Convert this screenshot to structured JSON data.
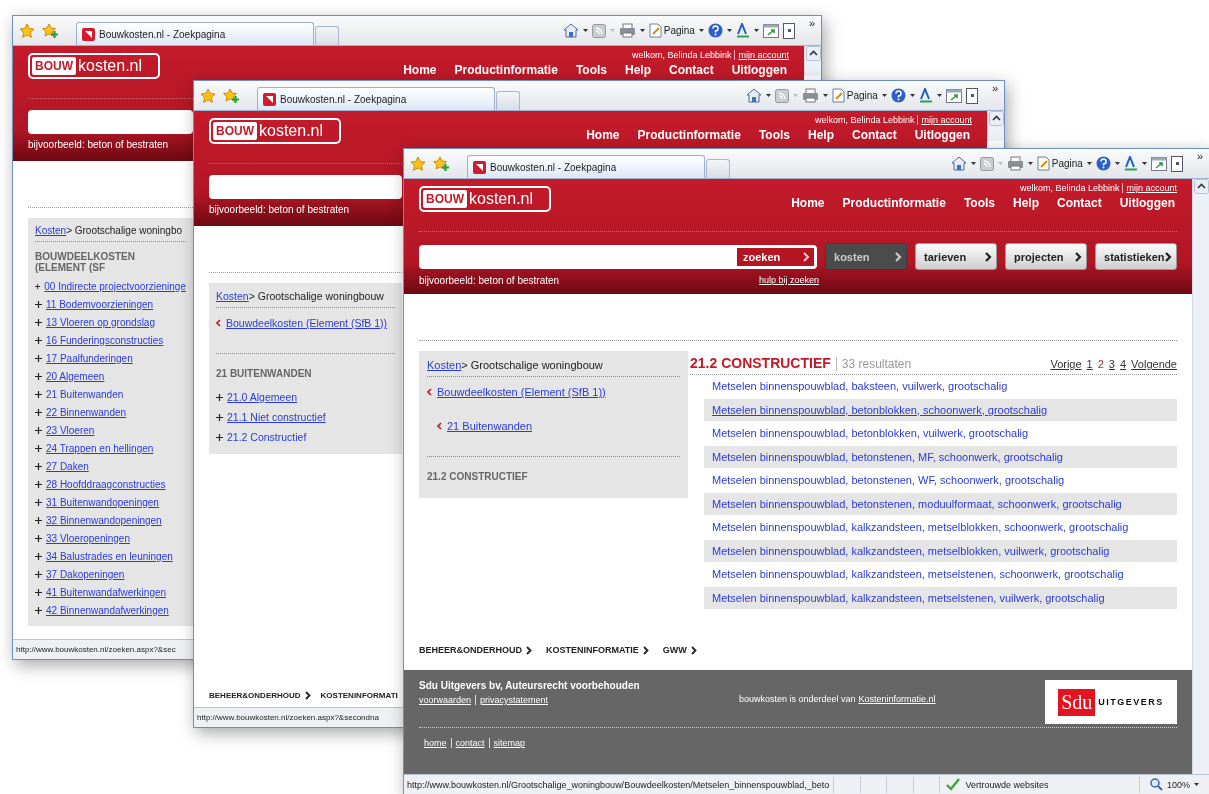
{
  "windows": [
    {
      "tab": "Bouwkosten.nl - Zoekpagina",
      "page_menu": "Pagina",
      "more": "»",
      "header": {
        "logo": [
          "BOUW",
          "kosten.nl"
        ],
        "welcome": "welkom, Belinda Lebbink",
        "account": "mijn account",
        "nav": [
          "Home",
          "Productinformatie",
          "Tools",
          "Help",
          "Contact",
          "Uitloggen"
        ],
        "hint": "bijvoorbeeld: beton of bestraten"
      },
      "sidebar": {
        "breadcrumb": {
          "link": "Kosten",
          "current": "> Grootschalige woningbo"
        },
        "heading": "BOUWDEELKOSTEN (ELEMENT (SF",
        "items": [
          {
            "label": "00 Indirecte projectvoorzieninge",
            "selected": false
          },
          {
            "label": "11 Bodemvoorzieningen",
            "selected": false
          },
          {
            "label": "13 Vloeren op grondslag",
            "selected": false
          },
          {
            "label": "16 Funderingsconstructies",
            "selected": false
          },
          {
            "label": "17 Paalfunderingen",
            "selected": false
          },
          {
            "label": "20 Algemeen",
            "selected": false
          },
          {
            "label": "21 Buitenwanden",
            "selected": true
          },
          {
            "label": "22 Binnenwanden",
            "selected": false
          },
          {
            "label": "23 Vloeren",
            "selected": false
          },
          {
            "label": "24 Trappen en hellingen",
            "selected": false
          },
          {
            "label": "27 Daken",
            "selected": false
          },
          {
            "label": "28 Hoofddraagconstructies",
            "selected": false
          },
          {
            "label": "31 Buitenwandopeningen",
            "selected": false
          },
          {
            "label": "32 Binnenwandopeningen",
            "selected": false
          },
          {
            "label": "33 Vloeropeningen",
            "selected": false
          },
          {
            "label": "34 Balustrades en leuningen",
            "selected": false
          },
          {
            "label": "37 Dakopeningen",
            "selected": false
          },
          {
            "label": "41 Buitenwandafwerkingen",
            "selected": false
          },
          {
            "label": "42 Binnenwandafwerkingen",
            "selected": false
          }
        ]
      },
      "status": {
        "url": "http://www.bouwkosten.nl/zoeken.aspx?&sec"
      }
    },
    {
      "tab": "Bouwkosten.nl - Zoekpagina",
      "page_menu": "Pagina",
      "more": "»",
      "header": {
        "logo": [
          "BOUW",
          "kosten.nl"
        ],
        "welcome": "welkom, Belinda Lebbink",
        "account": "mijn account",
        "nav": [
          "Home",
          "Productinformatie",
          "Tools",
          "Help",
          "Contact",
          "Uitloggen"
        ],
        "hint": "bijvoorbeeld: beton of bestraten"
      },
      "sidebar": {
        "breadcrumb": {
          "link": "Kosten",
          "current": "> Grootschalige woningbouw"
        },
        "back_links": [
          {
            "label": "Bouwdeelkosten (Element (SfB 1))"
          }
        ],
        "heading": "21 BUITENWANDEN",
        "items": [
          {
            "label": "21.0 Algemeen",
            "selected": false
          },
          {
            "label": "21.1 Niet constructief",
            "selected": false
          },
          {
            "label": "21.2 Constructief",
            "selected": true
          }
        ]
      },
      "footer_links": [
        {
          "label": "BEHEER&ONDERHOUD",
          "arrow": true
        },
        {
          "label": "KOSTENINFORMATI",
          "arrow": false
        }
      ],
      "status": {
        "url": "http://www.bouwkosten.nl/zoeken.aspx?&secondna"
      }
    },
    {
      "tab": "Bouwkosten.nl - Zoekpagina",
      "page_menu": "Pagina",
      "more": "»",
      "header": {
        "logo": [
          "BOUW",
          "kosten.nl"
        ],
        "welcome": "welkom, Belinda Lebbink",
        "account": "mijn account",
        "nav": [
          "Home",
          "Productinformatie",
          "Tools",
          "Help",
          "Contact",
          "Uitloggen"
        ],
        "hint": "bijvoorbeeld: beton of bestraten",
        "search_button": "zoeken",
        "help_link": "hulp bij zoeken",
        "categories": [
          {
            "label": "kosten",
            "selected": true
          },
          {
            "label": "tarieven",
            "selected": false
          },
          {
            "label": "projecten",
            "selected": false
          },
          {
            "label": "statistieken",
            "selected": false
          }
        ]
      },
      "sidebar": {
        "breadcrumb": {
          "link": "Kosten",
          "current": "> Grootschalige woningbouw"
        },
        "back_links": [
          {
            "label": "Bouwdeelkosten (Element (SfB 1))",
            "children": [
              {
                "label": "21 Buitenwanden"
              }
            ]
          }
        ],
        "heading": "21.2 CONSTRUCTIEF"
      },
      "results": {
        "title": "21.2 CONSTRUCTIEF",
        "count": "33 resultaten",
        "prev": "Vorige",
        "next": "Volgende",
        "pages": [
          {
            "label": "1",
            "selected": false
          },
          {
            "label": "2",
            "selected": true
          },
          {
            "label": "3",
            "selected": false
          },
          {
            "label": "4",
            "selected": false
          }
        ],
        "rows": [
          {
            "label": "Metselen binnenspouwblad, baksteen, vuilwerk, grootschalig",
            "hovered": false
          },
          {
            "label": "Metselen binnenspouwblad, betonblokken, schoonwerk, grootschalig",
            "hovered": true
          },
          {
            "label": "Metselen binnenspouwblad, betonblokken, vuilwerk, grootschalig",
            "hovered": false
          },
          {
            "label": "Metselen binnenspouwblad, betonstenen, MF, schoonwerk, grootschalig",
            "hovered": false
          },
          {
            "label": "Metselen binnenspouwblad, betonstenen, WF, schoonwerk, grootschalig",
            "hovered": false
          },
          {
            "label": "Metselen binnenspouwblad, betonstenen, moduulformaat, schoonwerk, grootschalig",
            "hovered": false
          },
          {
            "label": "Metselen binnenspouwblad, kalkzandsteen, metselblokken, schoonwerk, grootschalig",
            "hovered": false
          },
          {
            "label": "Metselen binnenspouwblad, kalkzandsteen, metselblokken, vuilwerk, grootschalig",
            "hovered": false
          },
          {
            "label": "Metselen binnenspouwblad, kalkzandsteen, metselstenen, schoonwerk, grootschalig",
            "hovered": false
          },
          {
            "label": "Metselen binnenspouwblad, kalkzandsteen, metselstenen, vuilwerk, grootschalig",
            "hovered": false
          }
        ]
      },
      "footer_links": [
        {
          "label": "BEHEER&ONDERHOUD",
          "arrow": true
        },
        {
          "label": "KOSTENINFORMATIE",
          "arrow": true
        },
        {
          "label": "GWW",
          "arrow": true
        }
      ],
      "footer": {
        "copyright": "Sdu Uitgevers bv, Auteursrecht voorbehouden",
        "legal_links": [
          "voorwaarden",
          "privacystatement"
        ],
        "note": "bouwkosten is onderdeel van",
        "note_link": "Kosteninformatie.nl",
        "logo": [
          "Sdu",
          "UITGEVERS"
        ],
        "links": [
          "home",
          "contact",
          "sitemap"
        ]
      },
      "status": {
        "url": "http://www.bouwkosten.nl/Grootschalige_woningbouw/Bouwdeelkosten/Metselen_binnenspouwblad,_beto",
        "zone": "Vertrouwde websites",
        "zoom": "100%"
      }
    }
  ]
}
